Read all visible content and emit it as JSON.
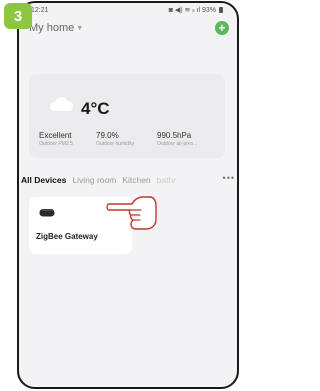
{
  "step_badge": "3",
  "status_bar": {
    "time": "12:21",
    "indicators": "◙ ◀) ≋ ᵢₗ ıl 93%"
  },
  "header": {
    "home_name": "My home",
    "add_icon": "plus-icon"
  },
  "weather": {
    "temperature": "4°C",
    "icon": "cloud-icon",
    "metrics": [
      {
        "value": "Excellent",
        "label": "Outdoor PM2.5"
      },
      {
        "value": "79.0%",
        "label": "Outdoor humidity"
      },
      {
        "value": "990.5hPa",
        "label": "Outdoor air pres..."
      }
    ]
  },
  "tabs": [
    "All Devices",
    "Living room",
    "Kitchen",
    "bathr"
  ],
  "devices": [
    {
      "name": "ZigBee Gateway",
      "icon": "gateway-icon"
    }
  ],
  "colors": {
    "accent": "#8dc63f",
    "add_button": "#5cb85c"
  }
}
